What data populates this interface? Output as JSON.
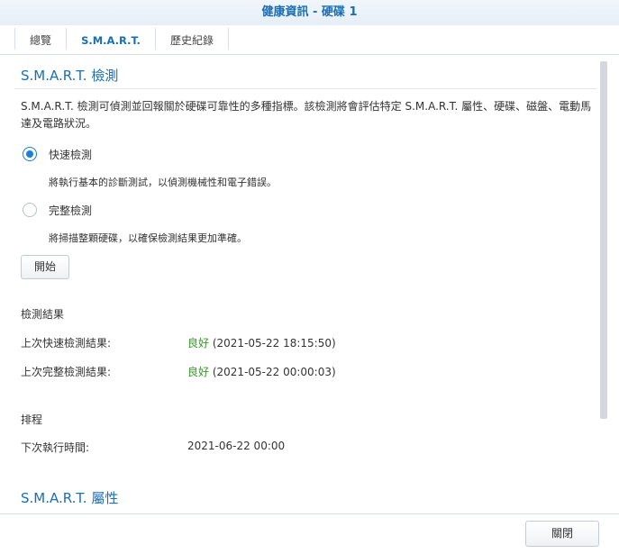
{
  "window": {
    "title": "健康資訊 - 硬碟 1"
  },
  "tabs": [
    {
      "label": "總覽"
    },
    {
      "label": "S.M.A.R.T."
    },
    {
      "label": "歷史紀錄"
    }
  ],
  "smart_test": {
    "title": "S.M.A.R.T. 檢測",
    "description": "S.M.A.R.T. 檢測可偵測並回報關於硬碟可靠性的多種指標。該檢測將會評估特定 S.M.A.R.T. 屬性、硬碟、磁盤、電動馬達及電路狀況。",
    "quick": {
      "label": "快速檢測",
      "description": "將執行基本的診斷測試，以偵測機械性和電子錯誤。",
      "selected": true
    },
    "extended": {
      "label": "完整檢測",
      "description": "將掃描整顆硬碟，以確保檢測結果更加準確。",
      "selected": false
    },
    "start_button": "開始"
  },
  "results": {
    "title": "檢測結果",
    "quick_label": "上次快速檢測結果:",
    "quick_status": "良好",
    "quick_time": "(2021-05-22 18:15:50)",
    "extended_label": "上次完整檢測結果:",
    "extended_status": "良好",
    "extended_time": "(2021-05-22 00:00:03)"
  },
  "schedule": {
    "title": "排程",
    "next_label": "下次執行時間:",
    "next_value": "2021-06-22 00:00"
  },
  "attributes": {
    "title": "S.M.A.R.T. 屬性"
  },
  "footer": {
    "close_button": "關閉"
  },
  "colors": {
    "accent": "#1a6eb3",
    "good": "#3a9a2c",
    "radio": "#1a7ee0"
  }
}
